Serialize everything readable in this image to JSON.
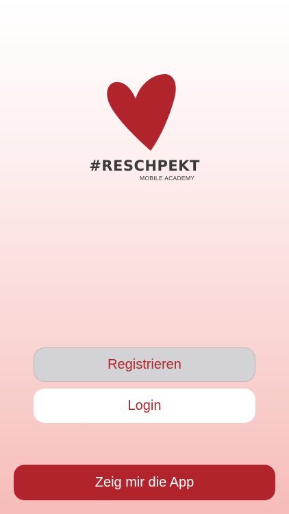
{
  "brand": {
    "name": "#RESCHPEKT",
    "tagline": "MOBILE ACADEMY",
    "logo_icon": "heart-icon",
    "accent_color": "#b1242c"
  },
  "actions": {
    "register_label": "Registrieren",
    "login_label": "Login",
    "demo_label": "Zeig mir die App"
  }
}
